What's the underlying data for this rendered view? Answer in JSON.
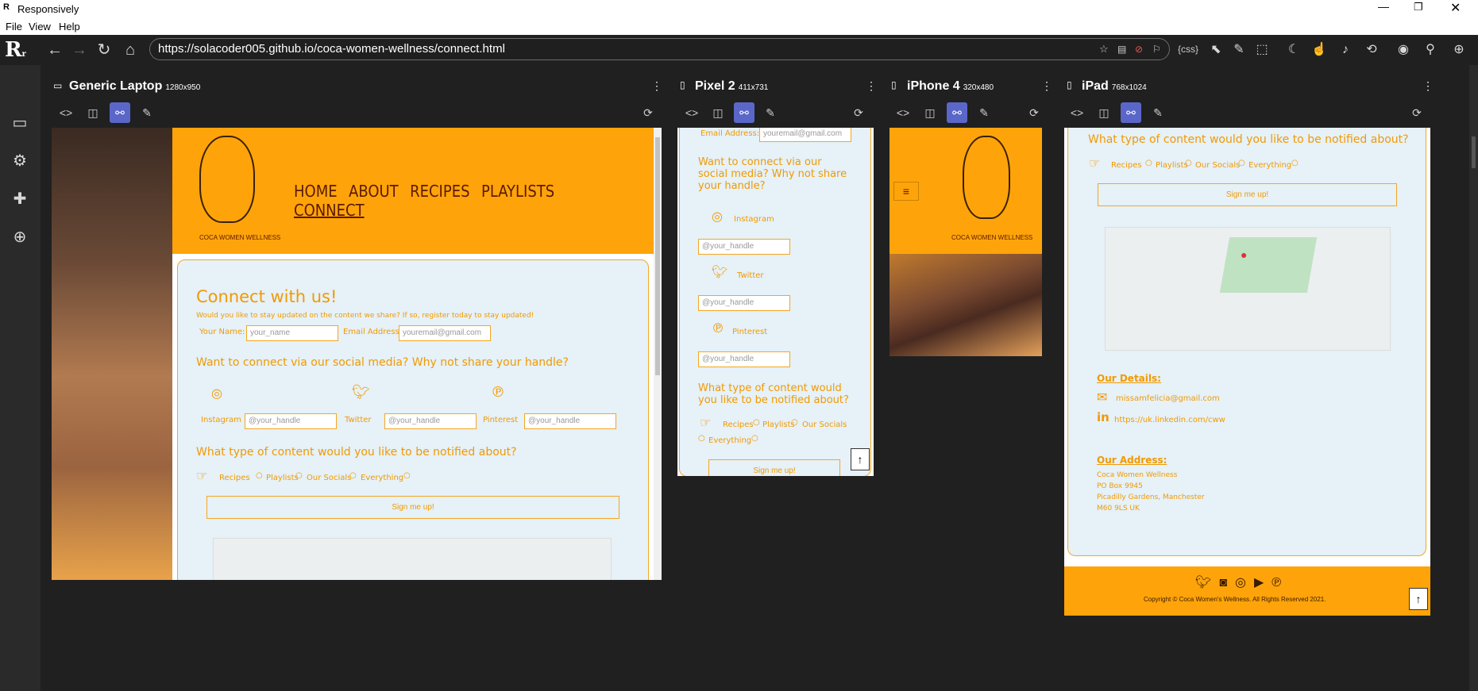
{
  "app": {
    "title": "Responsively",
    "menu": [
      "File",
      "View",
      "Help"
    ]
  },
  "url": "https://solacoder005.github.io/coca-women-wellness/connect.html",
  "toolbar": {
    "css_label": "{css}"
  },
  "devices": [
    {
      "name": "Generic Laptop",
      "size": "1280x950"
    },
    {
      "name": "Pixel 2",
      "size": "411x731"
    },
    {
      "name": "iPhone 4",
      "size": "320x480"
    },
    {
      "name": "iPad",
      "size": "768x1024"
    }
  ],
  "site": {
    "brand": "COCA WOMEN WELLNESS",
    "nav": [
      "HOME",
      "ABOUT",
      "RECIPES",
      "PLAYLISTS",
      "CONNECT"
    ],
    "connect_title": "Connect with us!",
    "connect_sub": "Would you like to stay updated on the content we share? If so, register today to stay updated!",
    "name_label": "Your Name:",
    "name_placeholder": "your_name",
    "email_label": "Email Address:",
    "email_placeholder": "youremail@gmail.com",
    "social_q": "Want to connect via our social media? Why not share your handle?",
    "instagram": "Instagram",
    "twitter": "Twitter",
    "pinterest": "Pinterest",
    "handle_placeholder": "@your_handle",
    "content_q": "What type of content would you like to be notified about?",
    "opts": [
      "Recipes",
      "Playlists",
      "Our Socials",
      "Everything"
    ],
    "signup": "Sign me up!",
    "details_title": "Our Details:",
    "email": "missamfelicia@gmail.com",
    "linkedin": "https://uk.linkedin.com/cww",
    "address_title": "Our Address:",
    "address": [
      "Coca Women Wellness",
      "PO Box 9945",
      "Picadilly Gardens, Manchester",
      "M60 9LS UK"
    ],
    "copyright": "Copyright © Coca Women's Wellness. All Rights Reserved 2021."
  },
  "pixel": {
    "social_q": "Want to connect via our social media? Why not share your handle?",
    "content_q": "What type of content would you like to be notified about?"
  },
  "colors": {
    "accent": "#fea40a",
    "panel": "#e6f1f8",
    "text_orange": "#f19a00",
    "active_tool": "#5a67c8"
  }
}
